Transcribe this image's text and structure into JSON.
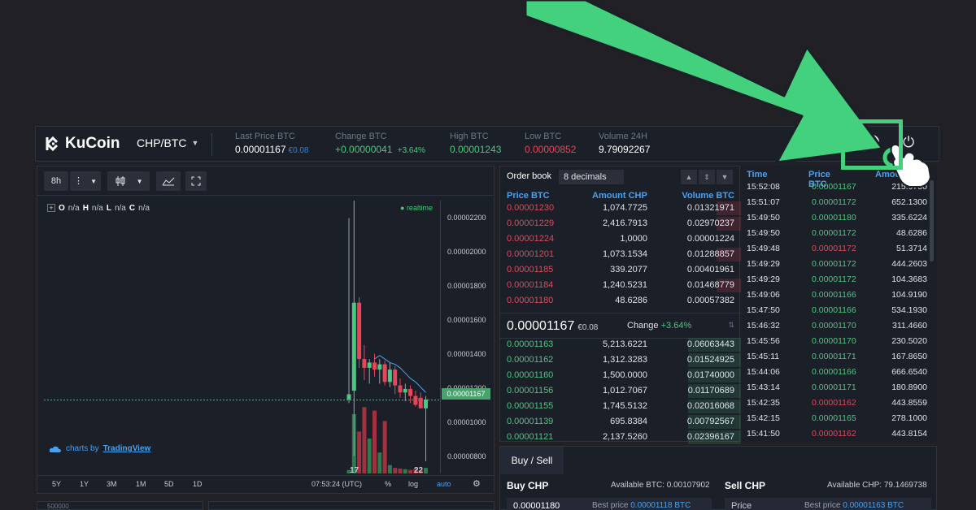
{
  "header": {
    "logo_text": "KuCoin",
    "pair": "CHP/BTC",
    "stats": [
      {
        "label": "Last Price BTC",
        "value": "0.00001167",
        "sub": "€0.08"
      },
      {
        "label": "Change BTC",
        "value": "+0.00000041",
        "sub": "+3.64%"
      },
      {
        "label": "High BTC",
        "value": "0.00001243",
        "sub": ""
      },
      {
        "label": "Low BTC",
        "value": "0.00000852",
        "sub": ""
      },
      {
        "label": "Volume 24H",
        "value": "9.79092267",
        "sub": ""
      }
    ],
    "currency_icon": "$",
    "power_icon": "⏻"
  },
  "chart": {
    "toolbar": {
      "interval": "8h",
      "more": "⋮",
      "candle_icon": "candlestick-icon",
      "indicator_icon": "indicator-icon",
      "fullscreen_icon": "fullscreen-icon"
    },
    "ohlc": {
      "o_label": "O",
      "o": "n/a",
      "h_label": "H",
      "h": "n/a",
      "l_label": "L",
      "l": "n/a",
      "c_label": "C",
      "c": "n/a"
    },
    "realtime": "realtime",
    "y_ticks": [
      "0.00002200",
      "0.00002000",
      "0.00001800",
      "0.00001600",
      "0.00001400",
      "0.00001200",
      "0.00001000",
      "0.00000800"
    ],
    "current_price_tag": "0.00001167",
    "x_ticks": [
      "17",
      "22"
    ],
    "tv_prefix": "charts by",
    "tv_link": "TradingView",
    "ranges": [
      "5Y",
      "1Y",
      "3M",
      "1M",
      "5D",
      "1D"
    ],
    "clock": "07:53:24 (UTC)",
    "pct": "%",
    "log": "log",
    "auto": "auto"
  },
  "chart_data": {
    "type": "bar",
    "title": "",
    "interval": "8h",
    "y_scale": "linear",
    "ylim": [
      7.5e-06,
      2.3e-05
    ],
    "current_price": 1.167e-05,
    "candles": [
      {
        "o": 1.17e-05,
        "h": 2.2e-05,
        "l": 1.15e-05,
        "c": 1.2e-05
      },
      {
        "o": 1.22e-05,
        "h": 2.3e-05,
        "l": 8.5e-06,
        "c": 1.72e-05
      },
      {
        "o": 1.72e-05,
        "h": 1.75e-05,
        "l": 1.35e-05,
        "c": 1.4e-05
      },
      {
        "o": 1.4e-05,
        "h": 1.48e-05,
        "l": 1.28e-05,
        "c": 1.35e-05
      },
      {
        "o": 1.35e-05,
        "h": 1.4e-05,
        "l": 1.26e-05,
        "c": 1.38e-05
      },
      {
        "o": 1.38e-05,
        "h": 1.43e-05,
        "l": 1.3e-05,
        "c": 1.34e-05
      },
      {
        "o": 1.34e-05,
        "h": 1.4e-05,
        "l": 1.26e-05,
        "c": 1.37e-05
      },
      {
        "o": 1.37e-05,
        "h": 1.39e-05,
        "l": 1.25e-05,
        "c": 1.27e-05
      },
      {
        "o": 1.27e-05,
        "h": 1.38e-05,
        "l": 1.24e-05,
        "c": 1.34e-05
      },
      {
        "o": 1.34e-05,
        "h": 1.36e-05,
        "l": 1.2e-05,
        "c": 1.25e-05
      },
      {
        "o": 1.25e-05,
        "h": 1.29e-05,
        "l": 1.18e-05,
        "c": 1.21e-05
      },
      {
        "o": 1.21e-05,
        "h": 1.26e-05,
        "l": 1.16e-05,
        "c": 1.23e-05
      },
      {
        "o": 1.23e-05,
        "h": 1.25e-05,
        "l": 1.15e-05,
        "c": 1.19e-05
      },
      {
        "o": 1.19e-05,
        "h": 1.22e-05,
        "l": 1.13e-05,
        "c": 1.14e-05
      },
      {
        "o": 1.18e-05,
        "h": 1.21e-05,
        "l": 1.12e-05,
        "c": 1.12e-05
      },
      {
        "o": 1.12e-05,
        "h": 1.19e-05,
        "l": 8.2e-06,
        "c": 1.17e-05
      }
    ],
    "volume_relative": [
      0.05,
      0.85,
      0.6,
      0.95,
      0.5,
      0.9,
      0.3,
      0.75,
      0.12,
      0.08,
      0.07,
      0.06,
      0.05,
      0.07,
      0.05,
      0.08
    ],
    "ma_line": [
      1.4e-05,
      1.42e-05,
      1.4e-05,
      1.38e-05,
      1.37e-05,
      1.35e-05,
      1.32e-05,
      1.29e-05,
      1.27e-05,
      1.24e-05,
      1.21e-05
    ]
  },
  "orderbook": {
    "title": "Order book",
    "decimals": "8 decimals",
    "columns": [
      "Price BTC",
      "Amount CHP",
      "Volume BTC"
    ],
    "asks": [
      {
        "price": "0.00001230",
        "amount": "1,074.7725",
        "volume": "0.01321971",
        "depth": 0.1
      },
      {
        "price": "0.00001229",
        "amount": "2,416.7913",
        "volume": "0.02970237",
        "depth": 0.1
      },
      {
        "price": "0.00001224",
        "amount": "1,0000",
        "volume": "0.00001224",
        "depth": 0.0
      },
      {
        "price": "0.00001201",
        "amount": "1,073.1534",
        "volume": "0.01288857",
        "depth": 0.1
      },
      {
        "price": "0.00001185",
        "amount": "339.2077",
        "volume": "0.00401961",
        "depth": 0.0
      },
      {
        "price": "0.00001184",
        "amount": "1,240.5231",
        "volume": "0.01468779",
        "depth": 0.1
      },
      {
        "price": "0.00001180",
        "amount": "48.6286",
        "volume": "0.00057382",
        "depth": 0.0
      }
    ],
    "last_price": "0.00001167",
    "last_price_sub": "€0.08",
    "change_label": "Change",
    "change_value": "+3.64%",
    "bids": [
      {
        "price": "0.00001163",
        "amount": "5,213.6221",
        "volume": "0.06063443",
        "depth": 0.22
      },
      {
        "price": "0.00001162",
        "amount": "1,312.3283",
        "volume": "0.01524925",
        "depth": 0.22
      },
      {
        "price": "0.00001160",
        "amount": "1,500.0000",
        "volume": "0.01740000",
        "depth": 0.22
      },
      {
        "price": "0.00001156",
        "amount": "1,012.7067",
        "volume": "0.01170689",
        "depth": 0.22
      },
      {
        "price": "0.00001155",
        "amount": "1,745.5132",
        "volume": "0.02016068",
        "depth": 0.22
      },
      {
        "price": "0.00001139",
        "amount": "695.8384",
        "volume": "0.00792567",
        "depth": 0.22
      },
      {
        "price": "0.00001121",
        "amount": "2,137.5260",
        "volume": "0.02396167",
        "depth": 0.22
      }
    ]
  },
  "history": {
    "columns": [
      "Time",
      "Price BTC",
      "Amount"
    ],
    "rows": [
      {
        "time": "15:52:08",
        "price": "0.00001167",
        "side": "buy",
        "amount": "215.9750"
      },
      {
        "time": "15:51:07",
        "price": "0.00001172",
        "side": "buy",
        "amount": "652.1300"
      },
      {
        "time": "15:49:50",
        "price": "0.00001180",
        "side": "buy",
        "amount": "335.6224"
      },
      {
        "time": "15:49:50",
        "price": "0.00001172",
        "side": "buy",
        "amount": "48.6286"
      },
      {
        "time": "15:49:48",
        "price": "0.00001172",
        "side": "sell",
        "amount": "51.3714"
      },
      {
        "time": "15:49:29",
        "price": "0.00001172",
        "side": "buy",
        "amount": "444.2603"
      },
      {
        "time": "15:49:29",
        "price": "0.00001172",
        "side": "buy",
        "amount": "104.3683"
      },
      {
        "time": "15:49:06",
        "price": "0.00001166",
        "side": "buy",
        "amount": "104.9190"
      },
      {
        "time": "15:47:50",
        "price": "0.00001166",
        "side": "buy",
        "amount": "534.1930"
      },
      {
        "time": "15:46:32",
        "price": "0.00001170",
        "side": "buy",
        "amount": "311.4660"
      },
      {
        "time": "15:45:56",
        "price": "0.00001170",
        "side": "buy",
        "amount": "230.5020"
      },
      {
        "time": "15:45:11",
        "price": "0.00001171",
        "side": "buy",
        "amount": "167.8650"
      },
      {
        "time": "15:44:06",
        "price": "0.00001166",
        "side": "buy",
        "amount": "666.6540"
      },
      {
        "time": "15:43:14",
        "price": "0.00001171",
        "side": "buy",
        "amount": "180.8900"
      },
      {
        "time": "15:42:35",
        "price": "0.00001162",
        "side": "sell",
        "amount": "443.8559"
      },
      {
        "time": "15:42:15",
        "price": "0.00001165",
        "side": "buy",
        "amount": "278.1000"
      },
      {
        "time": "15:41:50",
        "price": "0.00001162",
        "side": "sell",
        "amount": "443.8154"
      }
    ]
  },
  "buysell": {
    "tab": "Buy / Sell",
    "buy_title": "Buy CHP",
    "buy_avail": "Available BTC: 0.00107902",
    "buy_price": "0.00001180",
    "buy_best_label": "Best price",
    "buy_best": "0.00001118 BTC",
    "sell_title": "Sell CHP",
    "sell_avail": "Available CHP: 79.1469738",
    "sell_price": "Price",
    "sell_best_label": "Best price",
    "sell_best": "0.00001163 BTC"
  },
  "bottom": {
    "volume_label": "500000"
  },
  "colors": {
    "up": "#49c87f",
    "down": "#e8455a",
    "accent": "#4aa1f0",
    "annotation": "#43d17d"
  }
}
